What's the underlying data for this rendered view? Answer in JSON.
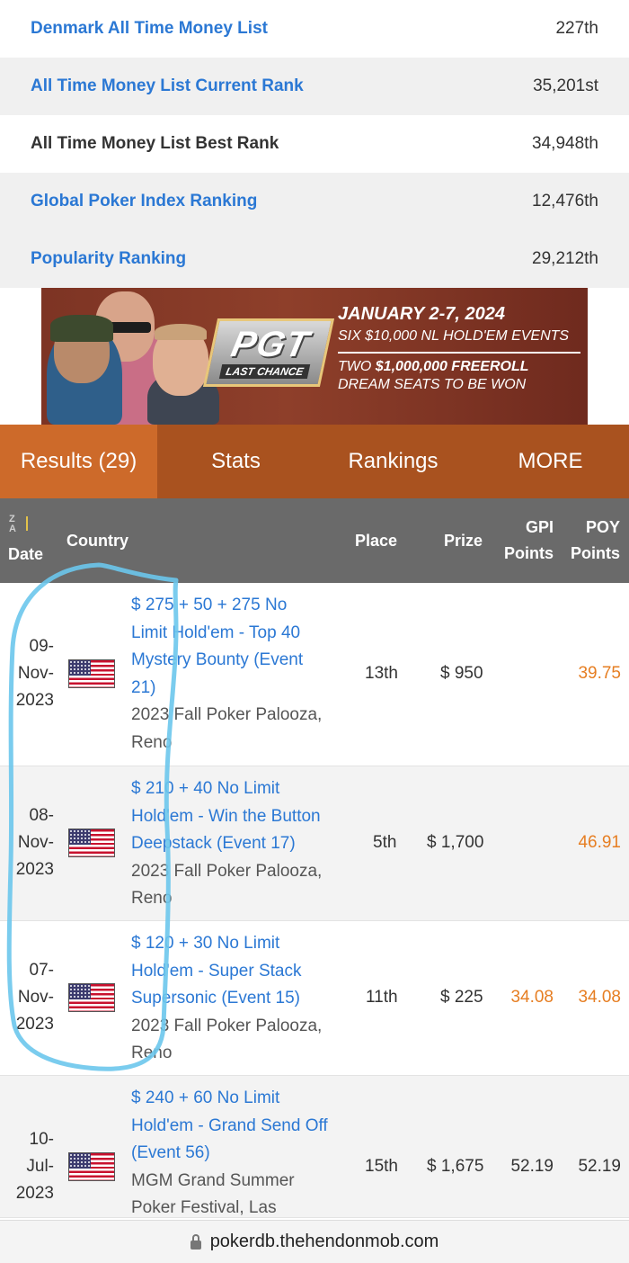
{
  "rankings": [
    {
      "label": "Denmark All Time Money List",
      "value": "227th",
      "link": true
    },
    {
      "label": "All Time Money List Current Rank",
      "value": "35,201st",
      "link": true
    },
    {
      "label": "All Time Money List Best Rank",
      "value": "34,948th",
      "link": false
    },
    {
      "label": "Global Poker Index Ranking",
      "value": "12,476th",
      "link": true
    },
    {
      "label": "Popularity Ranking",
      "value": "29,212th",
      "link": true
    }
  ],
  "banner": {
    "logo": "PGT",
    "logo_sub": "LAST CHANCE",
    "date": "JANUARY 2-7, 2024",
    "line1": "SIX $10,000 NL HOLD'EM EVENTS",
    "line2_pre": "TWO",
    "line2_bold": "$1,000,000 FREEROLL",
    "line3": "DREAM SEATS TO BE WON"
  },
  "tabs": [
    {
      "label": "Results (29)",
      "active": true
    },
    {
      "label": "Stats",
      "active": false
    },
    {
      "label": "Rankings",
      "active": false
    },
    {
      "label": "MORE",
      "active": false
    }
  ],
  "table_header": {
    "sort_icon": "sort-za-icon",
    "sort_letters": {
      "top": "Z",
      "bottom": "A"
    },
    "date": "Date",
    "country": "Country",
    "place": "Place",
    "prize": "Prize",
    "gpi_line1": "GPI",
    "gpi_line2": "Points",
    "poy_line1": "POY",
    "poy_line2": "Points"
  },
  "results": [
    {
      "date": [
        "09-",
        "Nov-",
        "2023"
      ],
      "country_icon": "us-flag-icon",
      "event_lines": [
        "$ 275 + 50 + 275 No",
        "Limit Hold'em - Top 40",
        "Mystery Bounty (Event",
        "21)"
      ],
      "venue_lines": [
        "2023 Fall Poker Palooza,",
        "Reno"
      ],
      "place": "13th",
      "prize": "$ 950",
      "gpi": "",
      "poy": "39.75"
    },
    {
      "date": [
        "08-",
        "Nov-",
        "2023"
      ],
      "country_icon": "us-flag-icon",
      "event_lines": [
        "$ 210 + 40 No Limit",
        "Hold'em - Win the Button",
        "Deepstack (Event 17)"
      ],
      "venue_lines": [
        "2023 Fall Poker Palooza,",
        "Reno"
      ],
      "place": "5th",
      "prize": "$ 1,700",
      "gpi": "",
      "poy": "46.91"
    },
    {
      "date": [
        "07-",
        "Nov-",
        "2023"
      ],
      "country_icon": "us-flag-icon",
      "event_lines": [
        "$ 120 + 30 No Limit",
        "Hold'em - Super Stack",
        "Supersonic (Event 15)"
      ],
      "venue_lines": [
        "2023 Fall Poker Palooza,",
        "Reno"
      ],
      "place": "11th",
      "prize": "$ 225",
      "gpi": "34.08",
      "poy": "34.08"
    },
    {
      "date": [
        "10-",
        "Jul-",
        "2023"
      ],
      "country_icon": "us-flag-icon",
      "event_lines": [
        "$ 240 + 60 No Limit",
        "Hold'em - Grand Send Off",
        "(Event 56)"
      ],
      "venue_lines": [
        "MGM Grand Summer",
        "Poker Festival, Las"
      ],
      "place": "15th",
      "prize": "$ 1,675",
      "gpi": "52.19",
      "poy": "52.19"
    }
  ],
  "url": {
    "icon": "lock-icon",
    "text": "pokerdb.thehendonmob.com"
  },
  "colors": {
    "link": "#2b78d4",
    "tab_bar": "#a9521f",
    "tab_active": "#cd6a2a",
    "table_header": "#6a6a6a",
    "points_orange": "#e67e22",
    "annotation": "#6cc6ec"
  }
}
